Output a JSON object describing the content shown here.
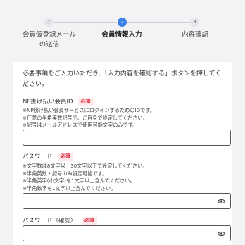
{
  "stepper": {
    "steps": [
      {
        "number": "✓",
        "label": "会員仮登録メール\nの送信",
        "state": "done"
      },
      {
        "number": "2",
        "label": "会員情報入力",
        "state": "active"
      },
      {
        "number": "3",
        "label": "内容確認",
        "state": "todo"
      }
    ],
    "colors": {
      "active": "#3b82e6",
      "inactive": "#e6e6ea"
    }
  },
  "form": {
    "intro": "必要事項をご入力いただき、「入力内容を確認する」ボタンを押してください。",
    "required_badge": "必須",
    "np_id": {
      "label": "NP掛け払い会員ID",
      "notes": [
        "※NP掛け払い会員サービスにログインするためのIDです。",
        "※任意の半角英数記号で、ご自身で設定してください。",
        "※記号はメールアドレスで使用可能文字のみです。"
      ],
      "value": ""
    },
    "password": {
      "label": "パスワード",
      "notes": [
        "※文字数は8文字以上30文字以下で設定してください。",
        "※半角英数・記号のみ設定可能です。",
        "※半角英字(小文字)を1文字以上含んでください。",
        "※半角数字を1文字以上含んでください。"
      ],
      "value": "",
      "toggle_icon": "eye-icon"
    },
    "password_confirm": {
      "label": "パスワード（確認）",
      "value": "",
      "toggle_icon": "eye-icon"
    }
  }
}
